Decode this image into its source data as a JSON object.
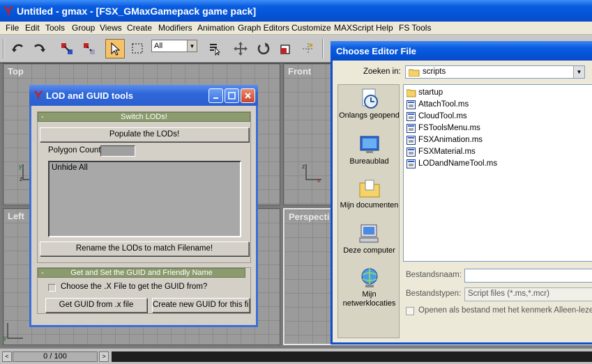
{
  "main_window": {
    "title": "Untitled - gmax - [FSX_GMaxGamepack game pack]"
  },
  "menu": [
    "File",
    "Edit",
    "Tools",
    "Group",
    "Views",
    "Create",
    "Modifiers",
    "Animation",
    "Graph Editors",
    "Customize",
    "MAXScript",
    "Help",
    "FS Tools"
  ],
  "toolbar": {
    "selection_filter": "All"
  },
  "viewports": {
    "top": "Top",
    "front": "Front",
    "left": "Left",
    "perspective": "Perspecti"
  },
  "timeline": {
    "frame_counter": "0 / 100",
    "prev": "<",
    "next": ">"
  },
  "lod_dialog": {
    "title": "LOD and GUID tools",
    "rollout_lods": {
      "collapse": "-",
      "title": "Switch LODs!"
    },
    "populate_button": "Populate the LODs!",
    "polygon_count_label": "Polygon Count:",
    "list_items": [
      "Unhide All"
    ],
    "rename_button": "Rename the LODs to match Filename!",
    "rollout_guid": {
      "collapse": "-",
      "title": "Get and Set the GUID and Friendly Name"
    },
    "choose_x_label": "Choose the .X File to get the GUID from?",
    "get_guid_button": "Get GUID from .x file",
    "create_guid_button": "Create new GUID for this file"
  },
  "file_dialog": {
    "title": "Choose Editor File",
    "look_in_label": "Zoeken in:",
    "look_in_value": "scripts",
    "places": [
      {
        "label": "Onlangs geopend",
        "icon": "recent-documents-icon"
      },
      {
        "label": "Bureaublad",
        "icon": "desktop-icon"
      },
      {
        "label": "Mijn documenten",
        "icon": "my-documents-icon"
      },
      {
        "label": "Deze computer",
        "icon": "my-computer-icon"
      },
      {
        "label": "Mijn netwerklocaties",
        "icon": "network-places-icon"
      }
    ],
    "files": [
      {
        "name": "startup",
        "type": "folder"
      },
      {
        "name": "AttachTool.ms",
        "type": "script"
      },
      {
        "name": "CloudTool.ms",
        "type": "script"
      },
      {
        "name": "FSToolsMenu.ms",
        "type": "script"
      },
      {
        "name": "FSXAnimation.ms",
        "type": "script"
      },
      {
        "name": "FSXMaterial.ms",
        "type": "script"
      },
      {
        "name": "LODandNameTool.ms",
        "type": "script"
      }
    ],
    "filename_label": "Bestandsnaam:",
    "filename_value": "",
    "filetype_label": "Bestandstypen:",
    "filetype_value": "Script files (*.ms,*.mcr)",
    "readonly_label": "Openen als bestand met het kenmerk Alleen-lezen"
  }
}
